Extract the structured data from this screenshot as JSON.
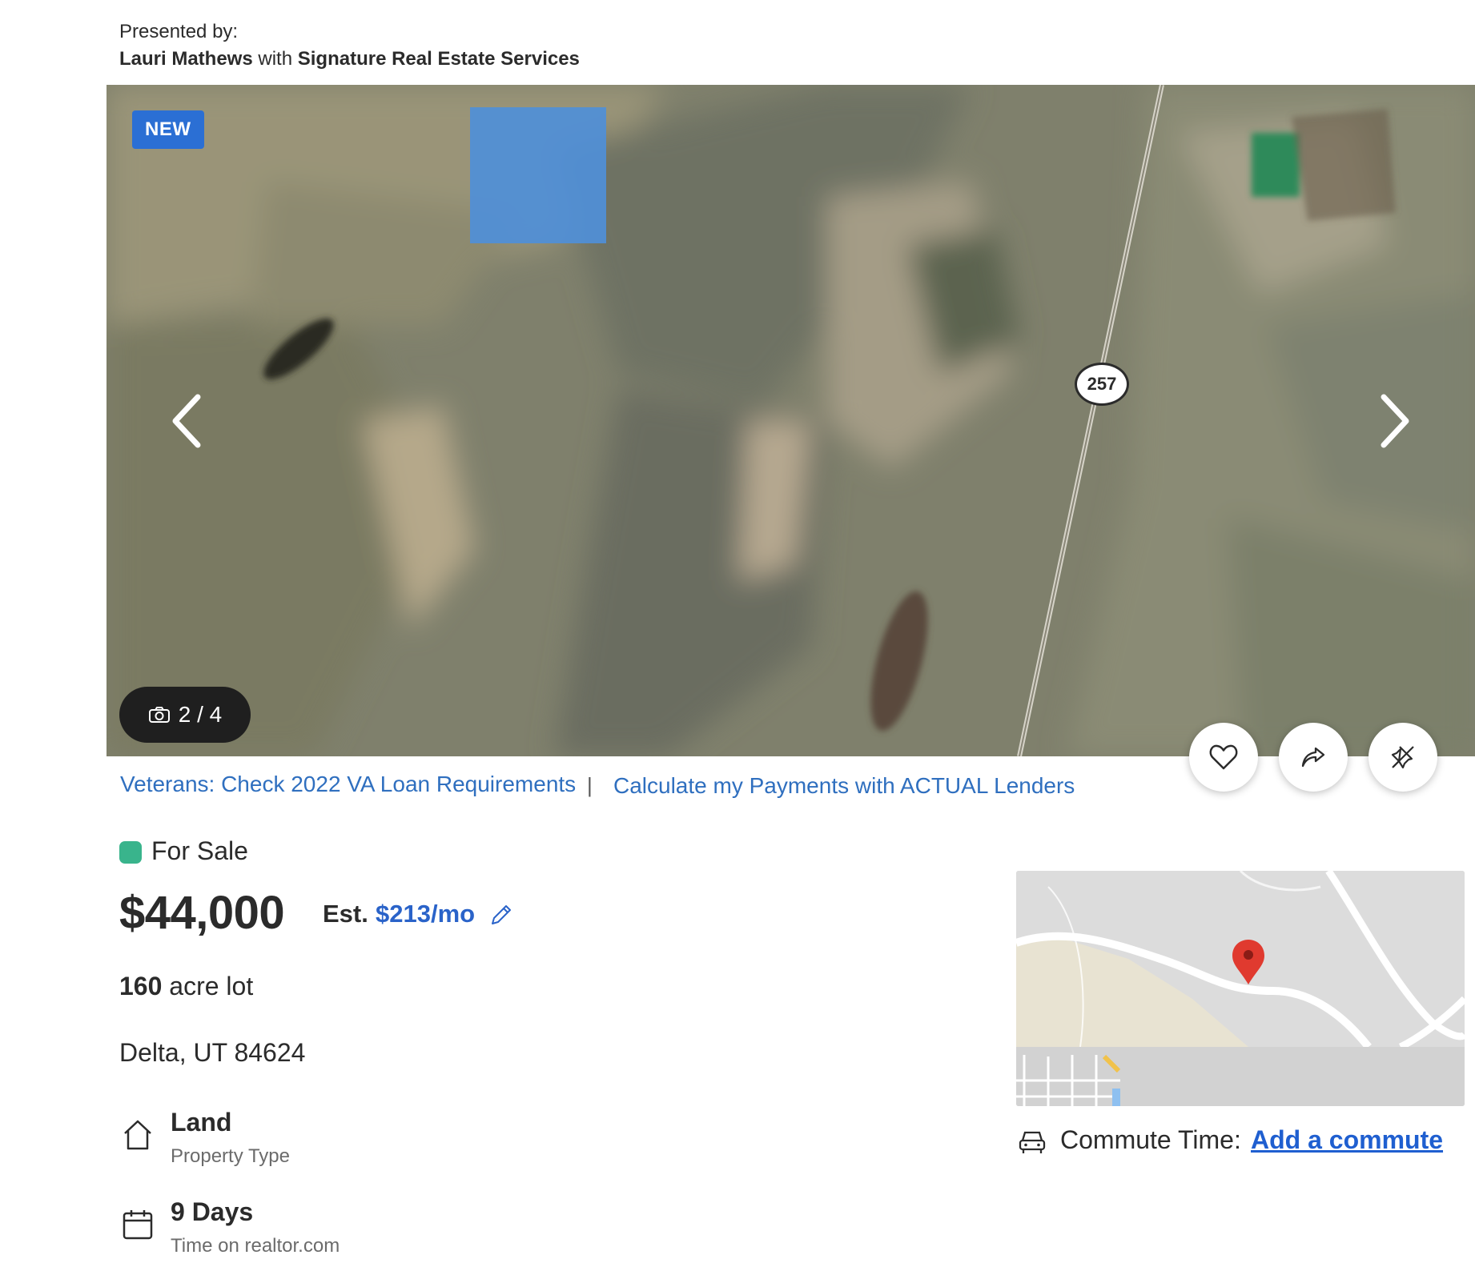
{
  "presenter": {
    "label": "Presented by:",
    "agent": "Lauri Mathews",
    "with_word": "with",
    "brokerage": "Signature Real Estate Services"
  },
  "gallery": {
    "badge": "NEW",
    "counter": "2 / 4",
    "current": 2,
    "total": 4,
    "road_sign": "257"
  },
  "links": {
    "va_loan": "Veterans: Check 2022 VA Loan Requirements",
    "separator": "|",
    "payments": "Calculate my Payments with ACTUAL Lenders"
  },
  "listing": {
    "status": "For Sale",
    "status_color": "#39b48c",
    "price": "$44,000",
    "est_label": "Est.",
    "est_monthly": "$213/mo",
    "lot_size": "160",
    "lot_unit": "acre lot",
    "address": "Delta, UT 84624"
  },
  "facts": [
    {
      "icon": "house-icon",
      "title": "Land",
      "subtitle": "Property Type"
    },
    {
      "icon": "calendar-icon",
      "title": "9 Days",
      "subtitle": "Time on realtor.com"
    }
  ],
  "commute": {
    "label": "Commute Time:",
    "link": "Add a commute"
  },
  "colors": {
    "link_blue": "#2f6fbf",
    "price_blue": "#2a63c9",
    "badge_blue": "#2b6fd4"
  }
}
